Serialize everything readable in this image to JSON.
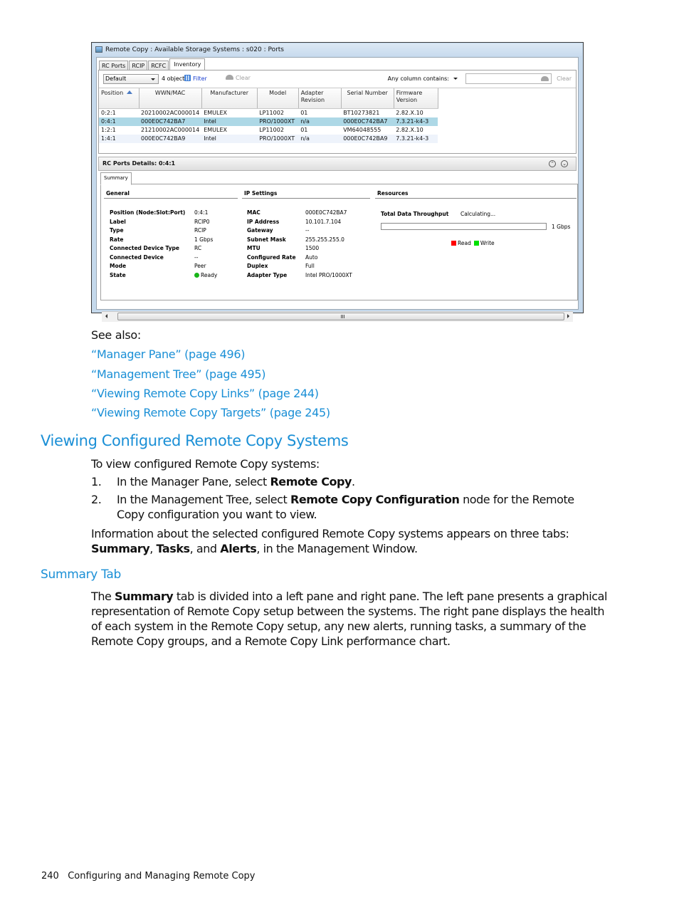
{
  "window": {
    "title": "Remote Copy : Available Storage Systems : s020 : Ports",
    "tabs": [
      "RC Ports",
      "RCIP",
      "RCFC",
      "Inventory"
    ],
    "active_tab": "Inventory",
    "toolbar": {
      "view_select": "Default",
      "object_count": "4 objects",
      "filter_label": "Filter",
      "clear_label": "Clear",
      "any_column_label": "Any column contains:",
      "search_value": "",
      "search_clear_label": "Clear"
    },
    "table": {
      "columns": [
        "Position",
        "WWN/MAC",
        "Manufacturer",
        "Model",
        "Adapter Revision",
        "Serial Number",
        "Firmware Version"
      ],
      "sort_column": "Position",
      "sort_direction": "ascending",
      "rows": [
        {
          "position": "0:2:1",
          "wwn": "20210002AC000014",
          "manufacturer": "EMULEX",
          "model": "LP11002",
          "revision": "01",
          "serial": "BT10273821",
          "firmware": "2.82.X.10",
          "selected": false
        },
        {
          "position": "0:4:1",
          "wwn": "000E0C742BA7",
          "manufacturer": "Intel",
          "model": "PRO/1000XT",
          "revision": "n/a",
          "serial": "000E0C742BA7",
          "firmware": "7.3.21-k4-3",
          "selected": true
        },
        {
          "position": "1:2:1",
          "wwn": "21210002AC000014",
          "manufacturer": "EMULEX",
          "model": "LP11002",
          "revision": "01",
          "serial": "VM64048555",
          "firmware": "2.82.X.10",
          "selected": false
        },
        {
          "position": "1:4:1",
          "wwn": "000E0C742BA9",
          "manufacturer": "Intel",
          "model": "PRO/1000XT",
          "revision": "n/a",
          "serial": "000E0C742BA9",
          "firmware": "7.3.21-k4-3",
          "selected": false
        }
      ]
    },
    "details": {
      "title": "RC Ports Details: 0:4:1",
      "tab": "Summary",
      "general": {
        "heading": "General",
        "fields": [
          {
            "label": "Position (Node:Slot:Port)",
            "value": "0:4:1"
          },
          {
            "label": "Label",
            "value": "RCIP0"
          },
          {
            "label": "Type",
            "value": "RCIP"
          },
          {
            "label": "Rate",
            "value": "1 Gbps"
          },
          {
            "label": "Connected Device Type",
            "value": "RC"
          },
          {
            "label": "Connected Device",
            "value": "--"
          },
          {
            "label": "Mode",
            "value": "Peer"
          },
          {
            "label": "State",
            "value": "Ready"
          }
        ]
      },
      "ip_settings": {
        "heading": "IP Settings",
        "fields": [
          {
            "label": "MAC",
            "value": "000E0C742BA7"
          },
          {
            "label": "IP Address",
            "value": "10.101.7.104"
          },
          {
            "label": "Gateway",
            "value": "--"
          },
          {
            "label": "Subnet Mask",
            "value": "255.255.255.0"
          },
          {
            "label": "MTU",
            "value": "1500"
          },
          {
            "label": "Configured Rate",
            "value": "Auto"
          },
          {
            "label": "Duplex",
            "value": "Full"
          },
          {
            "label": "Adapter Type",
            "value": "Intel PRO/1000XT"
          }
        ]
      },
      "resources": {
        "heading": "Resources",
        "throughput_label": "Total Data Throughput",
        "throughput_value": "Calculating...",
        "bar_fill_fraction": 0,
        "bar_max_label": "1 Gbps",
        "legend": [
          {
            "label": "Read",
            "color": "#ff0000"
          },
          {
            "label": "Write",
            "color": "#00e000"
          }
        ]
      }
    }
  },
  "doc": {
    "see_also_label": "See also:",
    "see_also_links": [
      "“Manager Pane” (page 496)",
      "“Management Tree” (page 495)",
      "“Viewing Remote Copy Links” (page 244)",
      "“Viewing Remote Copy Targets” (page 245)"
    ],
    "section_title": "Viewing Configured Remote Copy Systems",
    "intro": "To view configured Remote Copy systems:",
    "steps": [
      {
        "num": "1.",
        "pre": "In the Manager Pane, select ",
        "bold": "Remote Copy",
        "post": "."
      },
      {
        "num": "2.",
        "pre": "In the Management Tree, select ",
        "bold": "Remote Copy Configuration",
        "post": " node for the Remote Copy configuration you want to view."
      }
    ],
    "info": {
      "pre": "Information about the selected configured Remote Copy systems appears on three tabs: ",
      "b1": "Summary",
      "sep1": ", ",
      "b2": "Tasks",
      "sep2": ", and ",
      "b3": "Alerts",
      "post": ", in the Management Window."
    },
    "subsection_title": "Summary Tab",
    "summary": {
      "pre": "The ",
      "bold": "Summary",
      "post": " tab is divided into a left pane and right pane. The left pane presents a graphical representation of Remote Copy setup between the systems. The right pane displays the health of each system in the Remote Copy setup, any new alerts, running tasks, a summary of the Remote Copy groups, and a Remote Copy Link performance chart."
    },
    "footer": {
      "page_number": "240",
      "chapter": "Configuring and Managing Remote Copy"
    }
  }
}
